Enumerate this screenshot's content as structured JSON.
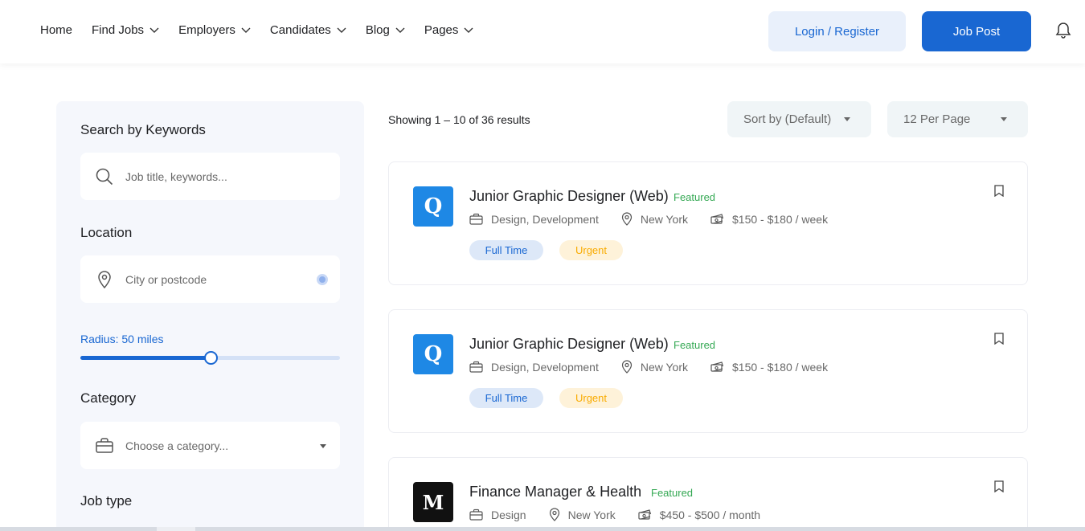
{
  "nav": {
    "items": [
      {
        "label": "Home",
        "dropdown": false
      },
      {
        "label": "Find Jobs",
        "dropdown": true
      },
      {
        "label": "Employers",
        "dropdown": true
      },
      {
        "label": "Candidates",
        "dropdown": true
      },
      {
        "label": "Blog",
        "dropdown": true
      },
      {
        "label": "Pages",
        "dropdown": true
      }
    ],
    "login_label": "Login / Register",
    "post_label": "Job Post",
    "notification_icon": "bell-icon"
  },
  "sidebar": {
    "keywords_title": "Search by Keywords",
    "keywords_placeholder": "Job title, keywords...",
    "location_title": "Location",
    "location_placeholder": "City or postcode",
    "radius_label": "Radius: 50 miles",
    "radius_fraction": 0.5,
    "category_title": "Category",
    "category_placeholder": "Choose a category...",
    "jobtype_title": "Job type"
  },
  "results": {
    "showing": "Showing 1 – 10 of 36 results",
    "sort_label": "Sort by (Default)",
    "per_page_label": "12 Per Page"
  },
  "jobs": [
    {
      "title": "Junior Graphic Designer (Web)",
      "featured": "Featured",
      "category": "Design, Development",
      "location": "New York",
      "salary": "$150 - $180 / week",
      "tags": [
        "Full Time",
        "Urgent"
      ],
      "logo_text": "Q",
      "logo_color": "#1e88e5"
    },
    {
      "title": "Junior Graphic Designer (Web)",
      "featured": "Featured",
      "category": "Design, Development",
      "location": "New York",
      "salary": "$150 - $180 / week",
      "tags": [
        "Full Time",
        "Urgent"
      ],
      "logo_text": "Q",
      "logo_color": "#1e88e5"
    },
    {
      "title": "Finance Manager & Health",
      "featured": "Featured",
      "category": "Design",
      "location": "New York",
      "salary": "$450 - $500 / month",
      "tags": [],
      "logo_text": "M",
      "logo_color": "#111111"
    }
  ],
  "colors": {
    "accent": "#1967d2",
    "featured": "#34a853",
    "urgent": "#f9ab00"
  }
}
